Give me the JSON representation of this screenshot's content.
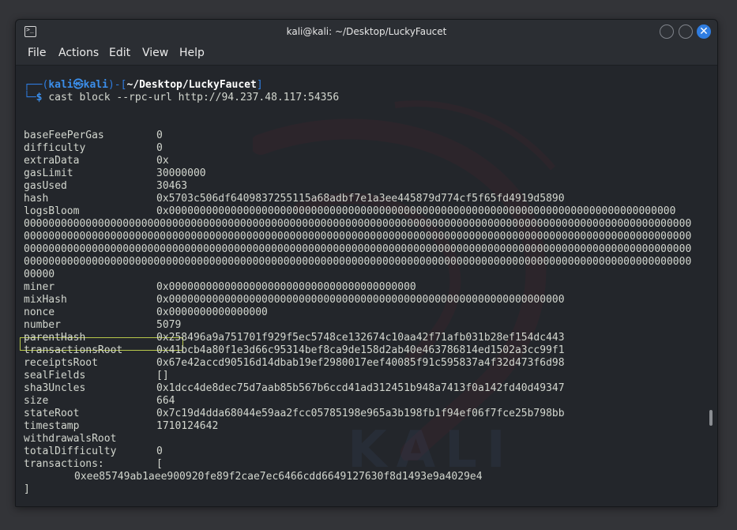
{
  "window": {
    "title": "kali@kali: ~/Desktop/LuckyFaucet",
    "icon": "terminal-icon",
    "controls": [
      "minimize-button",
      "maximize-button",
      "close-button"
    ],
    "close_glyph": "✕",
    "colors": {
      "accent": "#2f7de1",
      "background": "#23262b",
      "text": "#d3d7cf",
      "highlight_border": "#b8c84a"
    }
  },
  "menu": {
    "file": "File",
    "actions": "Actions",
    "edit": "Edit",
    "view": "View",
    "help": "Help"
  },
  "prompt": {
    "corner_top": "┌──(",
    "user": "kali",
    "at_symbol": "㉿",
    "host": "kali",
    "sep": ")-[",
    "path": "~/Desktop/LuckyFaucet",
    "close": "]",
    "corner_bottom": "└─",
    "dollar": "$",
    "command": "cast block --rpc-url http://94.237.48.117:54356"
  },
  "block": {
    "baseFeePerGas": {
      "key": "baseFeePerGas",
      "value": "0"
    },
    "difficulty": {
      "key": "difficulty",
      "value": "0"
    },
    "extraData": {
      "key": "extraData",
      "value": "0x"
    },
    "gasLimit": {
      "key": "gasLimit",
      "value": "30000000"
    },
    "gasUsed": {
      "key": "gasUsed",
      "value": "30463"
    },
    "hash": {
      "key": "hash",
      "value": "0x5703c506df6409837255115a68adbf7e1a3ee445879d774cf5f65fd4919d5890"
    },
    "logsBloom": {
      "key": "logsBloom",
      "first": "0x0000000000000000000000000000000000000000000000000000000000000000000000000000000000",
      "lines": [
        "000000000000000000000000000000000000000000000000000000000000000000000000000000000000000000000000000000000000",
        "000000000000000000000000000000000000000000000000000000000000000000000000000000000000000000000000000000000000",
        "000000000000000000000000000000000000000000000000000000000000000000000000000000000000000000000000000000000000",
        "000000000000000000000000000000000000000000000000000000000000000000000000000000000000000000000000000000000000"
      ],
      "last": "00000"
    },
    "miner": {
      "key": "miner",
      "value": "0x0000000000000000000000000000000000000000"
    },
    "mixHash": {
      "key": "mixHash",
      "value": "0x0000000000000000000000000000000000000000000000000000000000000000"
    },
    "nonce": {
      "key": "nonce",
      "value": "0x0000000000000000"
    },
    "number": {
      "key": "number",
      "value": "5079"
    },
    "parentHash": {
      "key": "parentHash",
      "value": "0x258496a9a751701f929f5ec5748ce132674c10aa42f71afb031b28ef154dc443"
    },
    "transactionsRoot": {
      "key": "transactionsRoot",
      "value": "0x41bcb4a80f1e3d66c95314bef8ca9de158d2ab40e463786814ed1502a3cc99f1"
    },
    "receiptsRoot": {
      "key": "receiptsRoot",
      "value": "0x67e42accd90516d14dbab19ef2980017eef40085f91c595837a4f32d473f6d98"
    },
    "sealFields": {
      "key": "sealFields",
      "value": "[]"
    },
    "sha3Uncles": {
      "key": "sha3Uncles",
      "value": "0x1dcc4de8dec75d7aab85b567b6ccd41ad312451b948a7413f0a142fd40d49347"
    },
    "size": {
      "key": "size",
      "value": "664"
    },
    "stateRoot": {
      "key": "stateRoot",
      "value": "0x7c19d4dda68044e59aa2fcc05785198e965a3b198fb1f94ef06f7fce25b798bb"
    },
    "timestamp": {
      "key": "timestamp",
      "value": "1710124642"
    },
    "withdrawalsRoot": {
      "key": "withdrawalsRoot",
      "value": ""
    },
    "totalDifficulty": {
      "key": "totalDifficulty",
      "value": "0"
    },
    "transactions": {
      "key": "transactions:",
      "open": "[",
      "item": "0xee85749ab1aee900920fe89f2cae7ec6466cdd6649127630f8d1493e9a4029e4",
      "close": "]"
    }
  }
}
